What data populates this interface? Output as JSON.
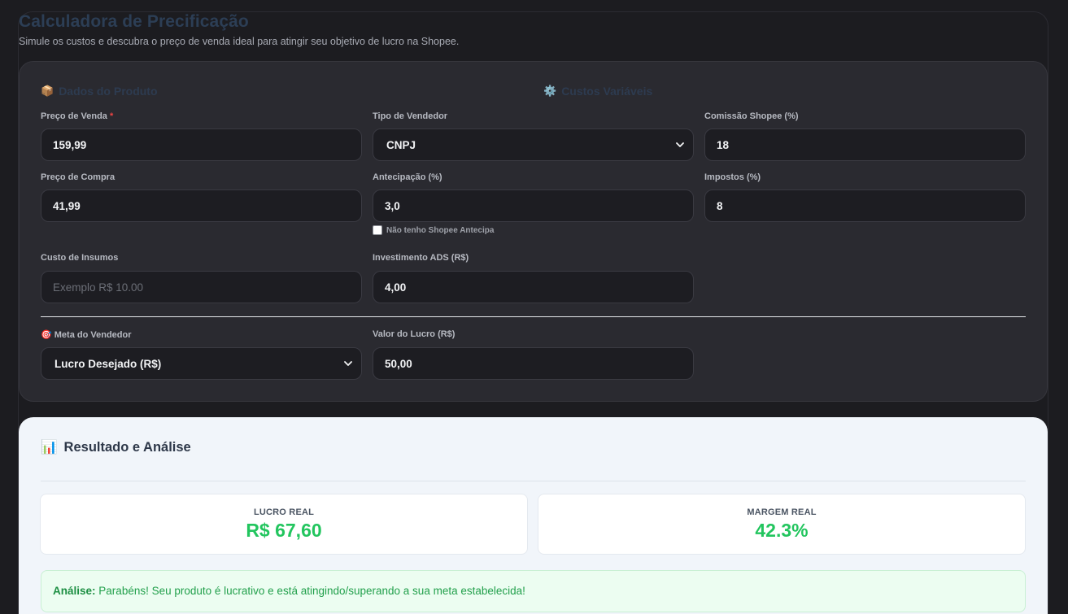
{
  "header": {
    "title": "Calculadora de Precificação",
    "subtitle": "Simule os custos e descubra o preço de venda ideal para atingir seu objetivo de lucro na Shopee."
  },
  "sections": {
    "product": {
      "icon": "package-icon",
      "emoji": "📦",
      "title": "Dados do Produto"
    },
    "variable": {
      "icon": "gear-icon",
      "emoji": "⚙️",
      "title": "Custos Variáveis"
    }
  },
  "form": {
    "preco_venda": {
      "label": "Preço de Venda",
      "required_mark": "*",
      "value": "159,99"
    },
    "preco_compra": {
      "label": "Preço de Compra",
      "value": "41,99"
    },
    "custo_insumos": {
      "label": "Custo de Insumos",
      "value": "",
      "placeholder": "Exemplo R$ 10.00"
    },
    "tipo_vendedor": {
      "label": "Tipo de Vendedor",
      "value": "CNPJ"
    },
    "antecipacao": {
      "label": "Antecipação (%)",
      "value": "3,0",
      "checkbox_label": "Não tenho Shopee Antecipa",
      "checked": false
    },
    "investimento_ads": {
      "label": "Investimento ADS (R$)",
      "value": "4,00"
    },
    "comissao": {
      "label": "Comissão Shopee (%)",
      "value": "18"
    },
    "impostos": {
      "label": "Impostos (%)",
      "value": "8"
    },
    "meta": {
      "label": "Meta do Vendedor",
      "emoji": "🎯",
      "value": "Lucro Desejado (R$)"
    },
    "valor_lucro": {
      "label": "Valor do Lucro (R$)",
      "value": "50,00"
    }
  },
  "results": {
    "emoji": "📊",
    "title": "Resultado e Análise",
    "lucro_label": "LUCRO REAL",
    "lucro_value": "R$ 67,60",
    "margem_label": "MARGEM REAL",
    "margem_value": "42.3%",
    "analysis_prefix": "Análise:",
    "analysis_text": "Parabéns! Seu produto é lucrativo e está atingindo/superando a sua meta estabelecida!",
    "accent_color": "#22c55e"
  }
}
